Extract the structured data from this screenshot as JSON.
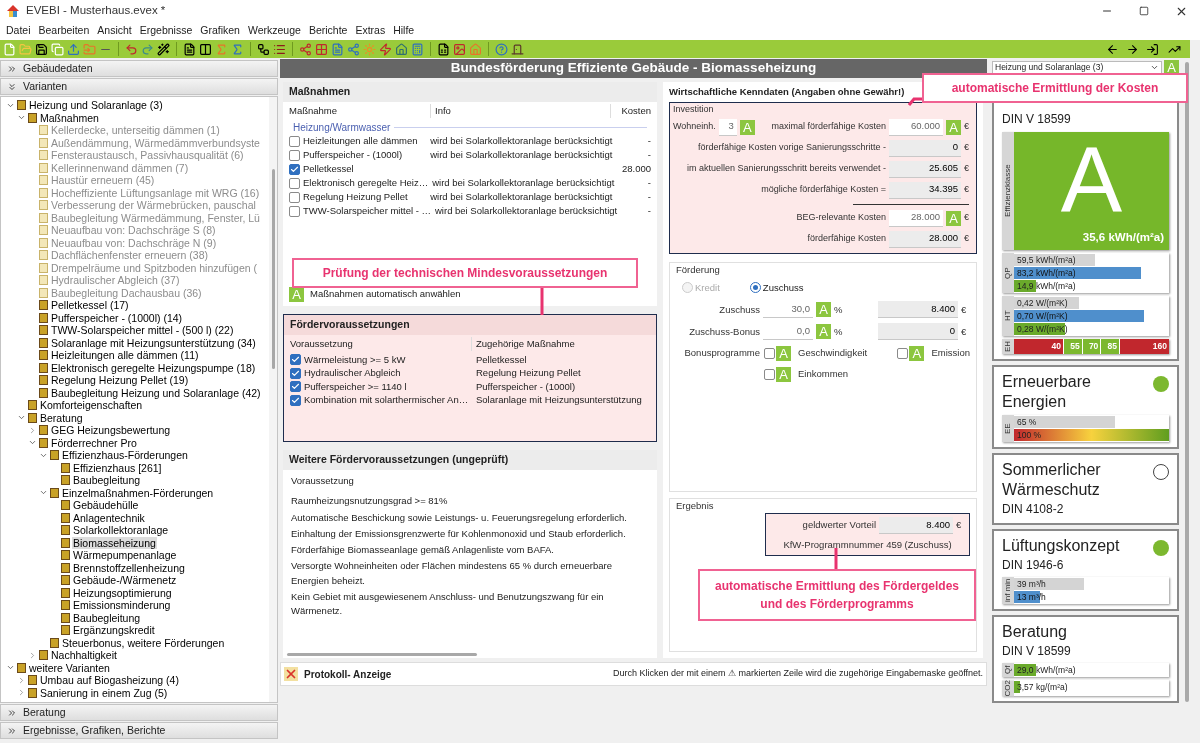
{
  "window": {
    "title": "EVEBI - Musterhaus.evex *"
  },
  "menu": [
    "Datei",
    "Bearbeiten",
    "Ansicht",
    "Ergebnisse",
    "Grafiken",
    "Werkzeuge",
    "Berichte",
    "Extras",
    "Hilfe"
  ],
  "left_panel": {
    "top_sections": [
      {
        "label": "Gebäudedaten",
        "expanded": false
      },
      {
        "label": "Varianten",
        "expanded": true
      }
    ],
    "tree": [
      {
        "label": "Heizung und Solaranlage (3)",
        "expanded": true,
        "selected": false,
        "children": [
          {
            "label": "Maßnahmen",
            "expanded": true,
            "selected": false,
            "children": [
              {
                "label": "Kellerdecke, unterseitig dämmen (1)",
                "disabled": true,
                "selected": false
              },
              {
                "label": "Außendämmung, Wärmedämmverbundsyste",
                "disabled": true,
                "selected": false
              },
              {
                "label": "Fensteraustausch, Passivhausqualität (6)",
                "disabled": true,
                "selected": false
              },
              {
                "label": "Kellerinnenwand dämmen (7)",
                "disabled": true,
                "selected": false
              },
              {
                "label": "Haustür erneuern (45)",
                "disabled": true,
                "selected": false
              },
              {
                "label": "Hocheffiziente Lüftungsanlage mit WRG (16)",
                "disabled": true,
                "selected": false
              },
              {
                "label": "Verbesserung der Wärmebrücken, pauschal",
                "disabled": true,
                "selected": false
              },
              {
                "label": "Baubegleitung Wärmedämmung, Fenster, Lü",
                "disabled": true,
                "selected": false
              },
              {
                "label": "Neuaufbau von: Dachschräge S (8)",
                "disabled": true,
                "selected": false
              },
              {
                "label": "Neuaufbau von: Dachschräge N (9)",
                "disabled": true,
                "selected": false
              },
              {
                "label": "Dachflächenfenster erneuern (38)",
                "disabled": true,
                "selected": false
              },
              {
                "label": "Drempelräume und Spitzboden hinzufügen (",
                "disabled": true,
                "selected": false
              },
              {
                "label": "Hydraulischer Abgleich (37)",
                "disabled": true,
                "selected": false
              },
              {
                "label": "Baubegleitung Dachausbau (36)",
                "disabled": true,
                "selected": false
              },
              {
                "label": "Pelletkessel (17)",
                "disabled": false,
                "selected": false
              },
              {
                "label": "Pufferspeicher - (1000l) (14)",
                "disabled": false,
                "selected": false
              },
              {
                "label": "TWW-Solarspeicher mittel - (500 l) (22)",
                "disabled": false,
                "selected": false
              },
              {
                "label": "Solaranlage mit Heizungsunterstützung (34)",
                "disabled": false,
                "selected": false
              },
              {
                "label": "Heizleitungen alle dämmen (11)",
                "disabled": false,
                "selected": false
              },
              {
                "label": "Elektronisch geregelte Heizungspumpe (18)",
                "disabled": false,
                "selected": false
              },
              {
                "label": "Regelung Heizung Pellet (19)",
                "disabled": false,
                "selected": false
              },
              {
                "label": "Baubegleitung Heizung und Solaranlage (42)",
                "disabled": false,
                "selected": false
              }
            ]
          },
          {
            "label": "Komforteigenschaften",
            "selected": false
          },
          {
            "label": "Beratung",
            "expanded": true,
            "selected": false,
            "children": [
              {
                "label": "GEG Heizungsbewertung",
                "expanded": false,
                "selected": false
              },
              {
                "label": "Förderrechner Pro",
                "expanded": true,
                "selected": false,
                "children": [
                  {
                    "label": "Effizienzhaus-Förderungen",
                    "expanded": true,
                    "selected": false,
                    "children": [
                      {
                        "label": "Effizienzhaus [261]",
                        "selected": false
                      },
                      {
                        "label": "Baubegleitung",
                        "selected": false
                      }
                    ]
                  },
                  {
                    "label": "Einzelmaßnahmen-Förderungen",
                    "expanded": true,
                    "selected": false,
                    "children": [
                      {
                        "label": "Gebäudehülle",
                        "selected": false
                      },
                      {
                        "label": "Anlagentechnik",
                        "selected": false
                      },
                      {
                        "label": "Solarkollektoranlage",
                        "selected": false
                      },
                      {
                        "label": "Biomasseheizung",
                        "selected": true
                      },
                      {
                        "label": "Wärmepumpenanlage",
                        "selected": false
                      },
                      {
                        "label": "Brennstoffzellenheizung",
                        "selected": false
                      },
                      {
                        "label": "Gebäude-/Wärmenetz",
                        "selected": false
                      },
                      {
                        "label": "Heizungsoptimierung",
                        "selected": false
                      },
                      {
                        "label": "Emissionsminderung",
                        "selected": false
                      },
                      {
                        "label": "Baubegleitung",
                        "selected": false
                      },
                      {
                        "label": "Ergänzungskredit",
                        "selected": false
                      }
                    ]
                  },
                  {
                    "label": "Steuerbonus, weitere Förderungen",
                    "selected": false
                  }
                ]
              },
              {
                "label": "Nachhaltigkeit",
                "expanded": false,
                "selected": false
              }
            ]
          }
        ]
      },
      {
        "label": "weitere Varianten",
        "expanded": true,
        "selected": false,
        "children": [
          {
            "label": "Umbau auf Biogasheizung (4)",
            "expanded": false,
            "selected": false
          },
          {
            "label": "Sanierung in einem Zug (5)",
            "expanded": false,
            "selected": false
          }
        ]
      }
    ],
    "bottom_sections": [
      {
        "label": "Beratung",
        "expanded": false
      },
      {
        "label": "Ergebnisse, Grafiken, Berichte",
        "expanded": false
      }
    ]
  },
  "center_title": "Bundesförderung Effiziente Gebäude - Biomasseheizung",
  "measures": {
    "title": "Maßnahmen",
    "columns": [
      "Maßnahme",
      "Info",
      "Kosten"
    ],
    "group": "Heizung/Warmwasser",
    "rows": [
      {
        "name": "Heizleitungen alle dämmen",
        "info": "wird bei Solarkollektoranlage berücksichtigt",
        "cost": "-",
        "checked": false
      },
      {
        "name": "Pufferspeicher - (1000l)",
        "info": "wird bei Solarkollektoranlage berücksichtigt",
        "cost": "-",
        "checked": false
      },
      {
        "name": "Pelletkessel",
        "cost": "28.000",
        "checked": true
      },
      {
        "name": "Elektronisch geregelte Heiz…",
        "info": "wird bei Solarkollektoranlage berücksichtigt",
        "cost": "-",
        "checked": false
      },
      {
        "name": "Regelung Heizung Pellet",
        "info": "wird bei Solarkollektoranlage berücksichtigt",
        "cost": "-",
        "checked": false
      },
      {
        "name": "TWW-Solarspeicher mittel - …",
        "info": "wird bei Solarkollektoranlage berücksichtigt",
        "cost": "-",
        "checked": false
      }
    ],
    "auto_select": {
      "badge": "A",
      "label": "Maßnahmen automatisch anwählen"
    }
  },
  "conditions": {
    "title": "Fördervoraussetzungen",
    "columns": [
      "Voraussetzung",
      "Zugehörige Maßnahme"
    ],
    "rows": [
      {
        "requirement": "Wärmeleistung >= 5 kW",
        "measure": "Pelletkessel",
        "checked": true
      },
      {
        "requirement": "Hydraulischer Abgleich",
        "measure": "Regelung Heizung Pellet",
        "checked": true
      },
      {
        "requirement": "Pufferspeicher >= 1140 l",
        "measure": "Pufferspeicher - (1000l)",
        "checked": true
      },
      {
        "requirement": "Kombination mit solarthermischer An…",
        "measure": "Solaranlage mit Heizungsunterstützung",
        "checked": true
      }
    ]
  },
  "further_conditions": {
    "title": "Weitere Fördervoraussetzungen (ungeprüft)",
    "column": "Voraussetzung",
    "lines": [
      "Raumheizungsnutzungsgrad >= 81%",
      "Automatische Beschickung sowie Leistungs- u. Feuerungsregelung erforderlich.",
      "Einhaltung der Emissionsgrenzwerte für Kohlenmonoxid und Staub erforderlich.",
      "Förderfähige Biomasseanlage gemäß Anlagenliste vom BAFA.",
      "Versorgte Wohneinheiten oder Flächen mindestens 65 % durch erneuerbare Energien beheizt.",
      "Kein Gebiet mit ausgewiesenem Anschluss- und Benutzungszwang für ein Wärmenetz."
    ]
  },
  "economics": {
    "title": "Wirtschaftliche Kenndaten (Angaben ohne Gewähr!)",
    "investment": {
      "legend": "Investition",
      "units": {
        "label": "Wohneinh.",
        "value": "3",
        "badge": "A"
      },
      "rows": [
        {
          "label": "maximal förderfähige Kosten",
          "value": "60.000",
          "badge": "A",
          "unit": "€",
          "kind": "auto"
        },
        {
          "label": "förderfähige Kosten vorige Sanierungsschritte -",
          "value": "0",
          "unit": "€",
          "kind": "computed"
        },
        {
          "label": "im aktuellen Sanierungsschritt bereits verwendet -",
          "value": "25.605",
          "unit": "€",
          "kind": "computed"
        },
        {
          "label": "mögliche förderfähige Kosten =",
          "value": "34.395",
          "unit": "€",
          "kind": "computed",
          "rule_below": true
        },
        {
          "label": "BEG-relevante Kosten",
          "value": "28.000",
          "badge": "A",
          "unit": "€",
          "kind": "auto"
        },
        {
          "label": "förderfähige Kosten",
          "value": "28.000",
          "unit": "€",
          "kind": "computed"
        }
      ]
    },
    "funding": {
      "legend": "Förderung",
      "options": [
        {
          "label": "Kredit",
          "selected": false,
          "disabled": true
        },
        {
          "label": "Zuschuss",
          "selected": true,
          "disabled": false
        }
      ],
      "rows": [
        {
          "label": "Zuschuss",
          "value": "30,0",
          "badge": "A",
          "unit": "%",
          "amount": "8.400",
          "amount_unit": "€"
        },
        {
          "label": "Zuschuss-Bonus",
          "value": "0,0",
          "badge": "A",
          "unit": "%",
          "amount": "0",
          "amount_unit": "€"
        }
      ],
      "bonus_label": "Bonusprogramme",
      "bonus": [
        {
          "label": "Geschwindigkeit",
          "badge": "A",
          "checked": false
        },
        {
          "label": "Emission",
          "badge": "A",
          "checked": false
        },
        {
          "label": "Einkommen",
          "badge": "A",
          "checked": false
        }
      ]
    },
    "result": {
      "legend": "Ergebnis",
      "label": "geldwerter Vorteil",
      "value": "8.400",
      "unit": "€",
      "program": "KfW-Programmnummer 459 (Zuschuss)"
    }
  },
  "status_bar": {
    "title": "Protokoll- Anzeige",
    "hint": "Durch Klicken der mit einem ⚠ markierten Zeile wird die zugehörige Eingabemaske geöffnet."
  },
  "ratings": {
    "dropdown": {
      "value": "Heizung und Solaranlage (3)",
      "badge": "A"
    },
    "cards": [
      {
        "kind": "energy",
        "subtitle": "DIN V 18599",
        "class_label": "Effizienzklasse",
        "class": "A",
        "class_value": "35,6 kWh/(m²a)",
        "groups": [
          {
            "label": "QP",
            "bars": [
              {
                "kind": "requirement",
                "reading": "59,5 kWh/(m²a)",
                "level": 0.52
              },
              {
                "kind": "reference",
                "reading": "83,2 kWh/(m²a)",
                "level": 0.82
              },
              {
                "kind": "actual",
                "reading": "14,9 kWh/(m²a)",
                "level": 0.14
              }
            ]
          },
          {
            "label": "HT",
            "bars": [
              {
                "kind": "requirement",
                "reading": "0,42 W/(m²K)",
                "level": 0.42
              },
              {
                "kind": "reference",
                "reading": "0,70 W/(m²K)",
                "level": 0.84
              },
              {
                "kind": "actual",
                "reading": "0,28 W/(m²K)",
                "level": 0.33
              }
            ]
          }
        ],
        "scale": {
          "label": "EH",
          "segments": [
            {
              "text": "40",
              "color": "#c1272d"
            },
            {
              "text": "55",
              "color": "#7cb82f"
            },
            {
              "text": "70",
              "color": "#7cb82f"
            },
            {
              "text": "85",
              "color": "#7cb82f"
            },
            {
              "text": "160",
              "color": "#c1272d"
            }
          ]
        }
      },
      {
        "kind": "status",
        "title": "Erneuerbare Energien",
        "fulfilled": true,
        "groups": [
          {
            "label": "EE",
            "bars": [
              {
                "kind": "requirement",
                "reading": "65 %",
                "level": 0.65
              },
              {
                "kind": "gradient",
                "reading": "100 %",
                "level": 1
              }
            ]
          }
        ]
      },
      {
        "kind": "status",
        "title": "Sommerlicher Wärmeschutz",
        "subtitle": "DIN 4108-2",
        "fulfilled": false
      },
      {
        "kind": "status",
        "title": "Lüftungskonzept",
        "subtitle": "DIN 1946-6",
        "fulfilled": true,
        "groups": [
          {
            "label": "inf min",
            "bars": [
              {
                "kind": "requirement",
                "reading": "39 m³/h",
                "level": 0.45
              },
              {
                "kind": "reference",
                "reading": "13 m³/h",
                "level": 0.17
              }
            ]
          }
        ]
      },
      {
        "kind": "plain",
        "title": "Beratung",
        "subtitle": "DIN V 18599",
        "groups": [
          {
            "label": "Qf",
            "bars": [
              {
                "kind": "actual",
                "reading": "29,0 kWh/(m²a)",
                "level": 0.14
              }
            ]
          },
          {
            "label": "CO2",
            "bars": [
              {
                "kind": "actual",
                "reading": "3,57 kg/(m²a)",
                "level": 0.04
              }
            ]
          }
        ]
      }
    ]
  },
  "annotations": [
    {
      "text": "automatische Ermittlung der Kosten"
    },
    {
      "text": "Prüfung der technischen Mindesvoraussetzungen"
    },
    {
      "text": "automatische Ermittlung des Fördergeldes und des Förderprogramms"
    }
  ]
}
